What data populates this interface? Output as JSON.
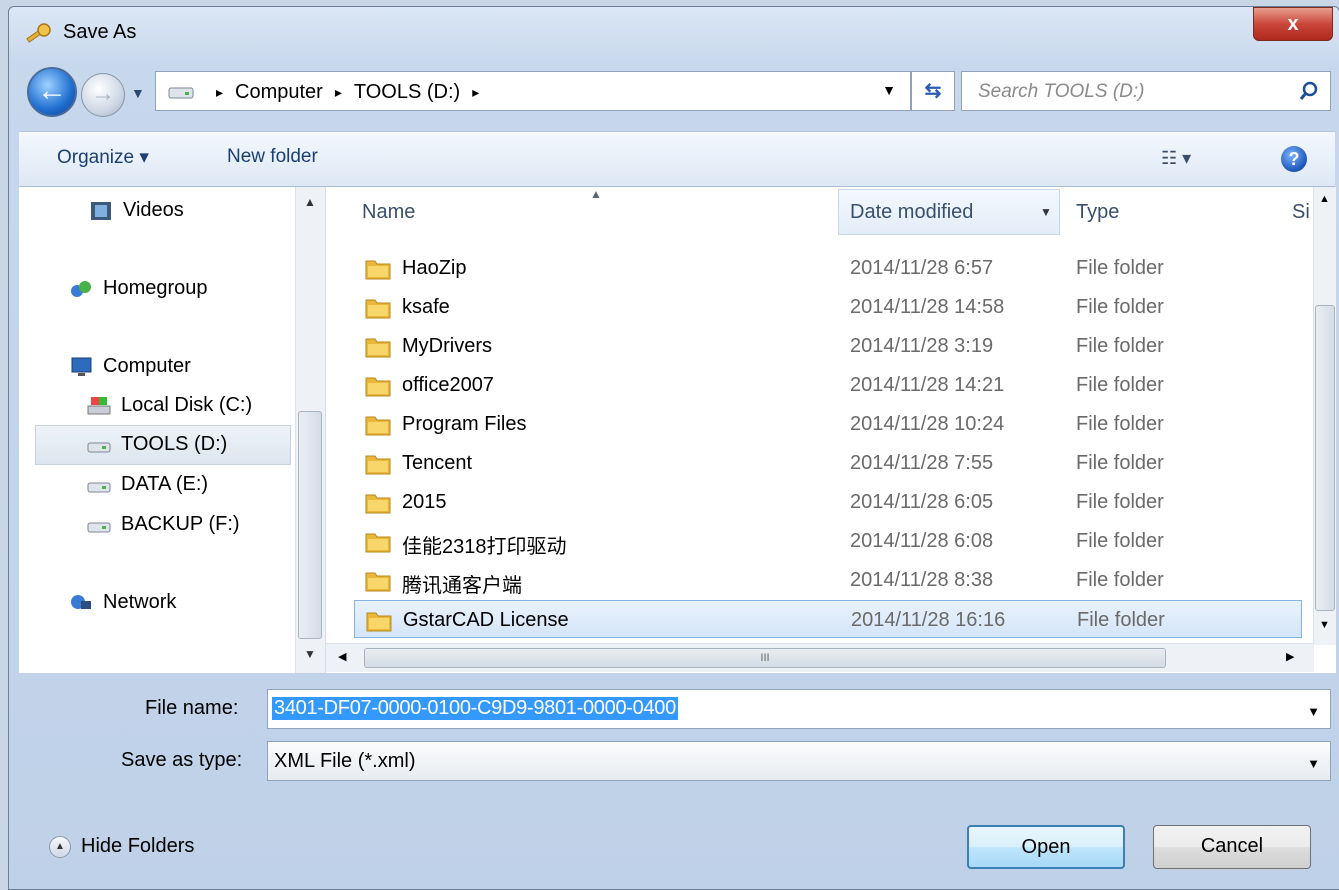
{
  "window": {
    "title": "Save As",
    "close_glyph": "x"
  },
  "address_bar": {
    "crumbs": [
      "Computer",
      "TOOLS (D:)"
    ],
    "separator": "▸",
    "search_placeholder": "Search TOOLS (D:)"
  },
  "toolbar": {
    "organize_label": "Organize ▾",
    "new_folder_label": "New folder",
    "view_label": "☷ ▾",
    "help_glyph": "?"
  },
  "nav_pane": {
    "items": [
      {
        "label": "Videos",
        "icon": "videos-icon"
      },
      {
        "label": "Homegroup",
        "icon": "homegroup-icon"
      },
      {
        "label": "Computer",
        "icon": "computer-icon"
      },
      {
        "label": "Local Disk (C:)",
        "icon": "local-disk-icon"
      },
      {
        "label": "TOOLS (D:)",
        "icon": "drive-icon",
        "selected": true
      },
      {
        "label": "DATA (E:)",
        "icon": "drive-icon"
      },
      {
        "label": "BACKUP (F:)",
        "icon": "drive-icon"
      },
      {
        "label": "Network",
        "icon": "network-icon"
      }
    ]
  },
  "file_list": {
    "columns": {
      "name": "Name",
      "date": "Date modified",
      "type": "Type",
      "size": "Si"
    },
    "rows": [
      {
        "name": "HaoZip",
        "date": "2014/11/28 6:57",
        "type": "File folder"
      },
      {
        "name": "ksafe",
        "date": "2014/11/28 14:58",
        "type": "File folder"
      },
      {
        "name": "MyDrivers",
        "date": "2014/11/28 3:19",
        "type": "File folder"
      },
      {
        "name": "office2007",
        "date": "2014/11/28 14:21",
        "type": "File folder"
      },
      {
        "name": "Program Files",
        "date": "2014/11/28 10:24",
        "type": "File folder"
      },
      {
        "name": "Tencent",
        "date": "2014/11/28 7:55",
        "type": "File folder"
      },
      {
        "name": "2015",
        "date": "2014/11/28 6:05",
        "type": "File folder"
      },
      {
        "name": "佳能2318打印驱动",
        "date": "2014/11/28 6:08",
        "type": "File folder"
      },
      {
        "name": "腾讯通客户端",
        "date": "2014/11/28 8:38",
        "type": "File folder"
      },
      {
        "name": "GstarCAD License",
        "date": "2014/11/28 16:16",
        "type": "File folder",
        "selected": true
      }
    ],
    "hscroll_thumb": "III"
  },
  "form": {
    "file_name_label": "File name:",
    "file_name_value": "3401-DF07-0000-0100-C9D9-9801-0000-0400",
    "save_type_label": "Save as type:",
    "save_type_value": "XML File (*.xml)"
  },
  "buttons": {
    "hide_folders": "Hide Folders",
    "open": "Open",
    "cancel": "Cancel"
  },
  "colors": {
    "selection": "#3399ff",
    "title_bar": "#dbe7f5",
    "close": "#c9473a"
  }
}
